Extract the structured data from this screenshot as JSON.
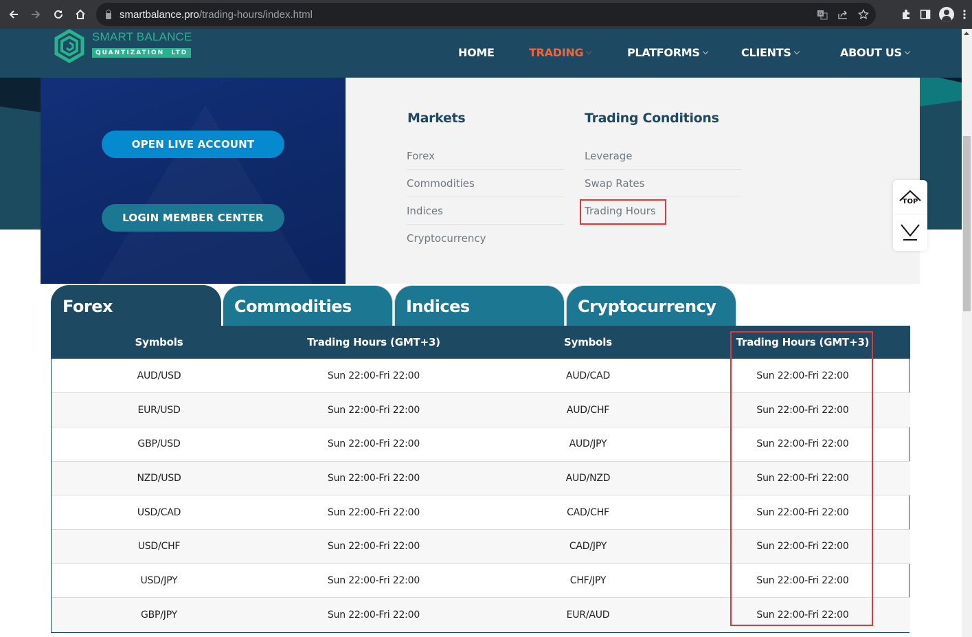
{
  "browser": {
    "url_host": "smartbalance.pro",
    "url_path": "/trading-hours/index.html"
  },
  "logo": {
    "title": "SMART BALANCE",
    "subtitle": "QUANTIZATION  LTD"
  },
  "nav": {
    "items": [
      {
        "label": "HOME",
        "has_dropdown": false,
        "active": false
      },
      {
        "label": "TRADING",
        "has_dropdown": true,
        "active": true
      },
      {
        "label": "PLATFORMS",
        "has_dropdown": true,
        "active": false
      },
      {
        "label": "CLIENTS",
        "has_dropdown": true,
        "active": false
      },
      {
        "label": "ABOUT US",
        "has_dropdown": true,
        "active": false
      }
    ]
  },
  "mega_menu": {
    "open_account_label": "OPEN LIVE ACCOUNT",
    "login_label": "LOGIN MEMBER CENTER",
    "markets": {
      "heading": "Markets",
      "links": [
        "Forex",
        "Commodities",
        "Indices",
        "Cryptocurrency"
      ]
    },
    "conditions": {
      "heading": "Trading Conditions",
      "links": [
        "Leverage",
        "Swap Rates",
        "Trading Hours"
      ],
      "highlighted": "Trading Hours"
    }
  },
  "float_widget": {
    "top_label": "TOP"
  },
  "tabs": [
    {
      "label": "Forex",
      "active": true
    },
    {
      "label": "Commodities",
      "active": false
    },
    {
      "label": "Indices",
      "active": false
    },
    {
      "label": "Cryptocurrency",
      "active": false
    }
  ],
  "table": {
    "headers": [
      "Symbols",
      "Trading Hours (GMT+3)",
      "Symbols",
      "Trading Hours (GMT+3)"
    ],
    "rows": [
      [
        "AUD/USD",
        "Sun 22:00-Fri 22:00",
        "AUD/CAD",
        "Sun 22:00-Fri 22:00"
      ],
      [
        "EUR/USD",
        "Sun 22:00-Fri 22:00",
        "AUD/CHF",
        "Sun 22:00-Fri 22:00"
      ],
      [
        "GBP/USD",
        "Sun 22:00-Fri 22:00",
        "AUD/JPY",
        "Sun 22:00-Fri 22:00"
      ],
      [
        "NZD/USD",
        "Sun 22:00-Fri 22:00",
        "AUD/NZD",
        "Sun 22:00-Fri 22:00"
      ],
      [
        "USD/CAD",
        "Sun 22:00-Fri 22:00",
        "CAD/CHF",
        "Sun 22:00-Fri 22:00"
      ],
      [
        "USD/CHF",
        "Sun 22:00-Fri 22:00",
        "CAD/JPY",
        "Sun 22:00-Fri 22:00"
      ],
      [
        "USD/JPY",
        "Sun 22:00-Fri 22:00",
        "CHF/JPY",
        "Sun 22:00-Fri 22:00"
      ],
      [
        "GBP/JPY",
        "Sun 22:00-Fri 22:00",
        "EUR/AUD",
        "Sun 22:00-Fri 22:00"
      ]
    ]
  },
  "colors": {
    "brand_dark": "#1d4a62",
    "brand_teal": "#1c7793",
    "accent_orange": "#f0663a",
    "logo_green": "#27b48d",
    "highlight_red": "#e53535"
  }
}
